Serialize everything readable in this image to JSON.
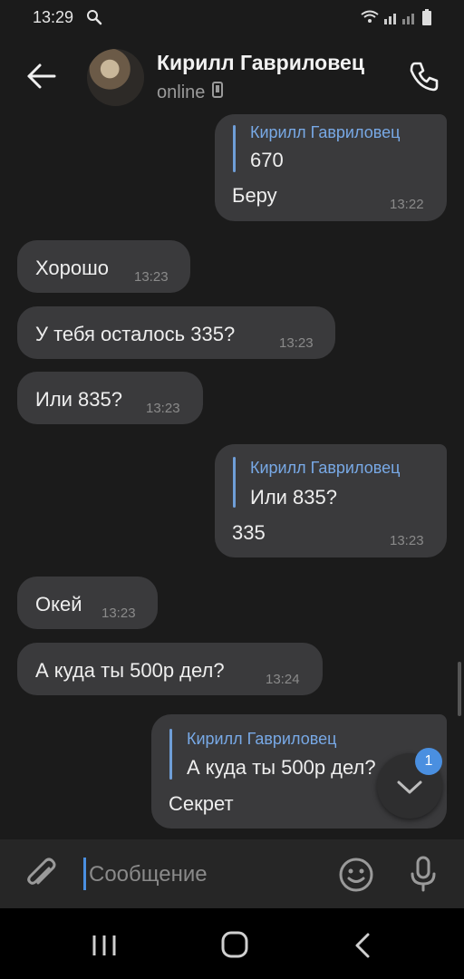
{
  "status_bar": {
    "time": "13:29"
  },
  "header": {
    "name": "Кирилл Гавриловец",
    "status": "online"
  },
  "messages": [
    {
      "side": "out",
      "reply_name": "Кирилл Гавриловец",
      "reply_text": "670",
      "text": "Беру",
      "time": "13:22"
    },
    {
      "side": "in",
      "text": "Хорошо",
      "time": "13:23"
    },
    {
      "side": "in",
      "text": "У тебя осталось 335?",
      "time": "13:23"
    },
    {
      "side": "in",
      "text": "Или 835?",
      "time": "13:23"
    },
    {
      "side": "out",
      "reply_name": "Кирилл Гавриловец",
      "reply_text": "Или 835?",
      "text": "335",
      "time": "13:23"
    },
    {
      "side": "in",
      "text": "Окей",
      "time": "13:23"
    },
    {
      "side": "in",
      "text": "А куда ты 500р дел?",
      "time": "13:24"
    },
    {
      "side": "out",
      "reply_name": "Кирилл Гавриловец",
      "reply_text": "А куда ты 500р дел?",
      "text": "Секрет",
      "time": ""
    }
  ],
  "scroll_down": {
    "unread_count": "1"
  },
  "composer": {
    "placeholder": "Сообщение",
    "value": ""
  },
  "colors": {
    "accent": "#4a8fe0",
    "bubble": "#3a3a3c",
    "background": "#1b1b1b",
    "reply_name": "#78a9e6"
  }
}
